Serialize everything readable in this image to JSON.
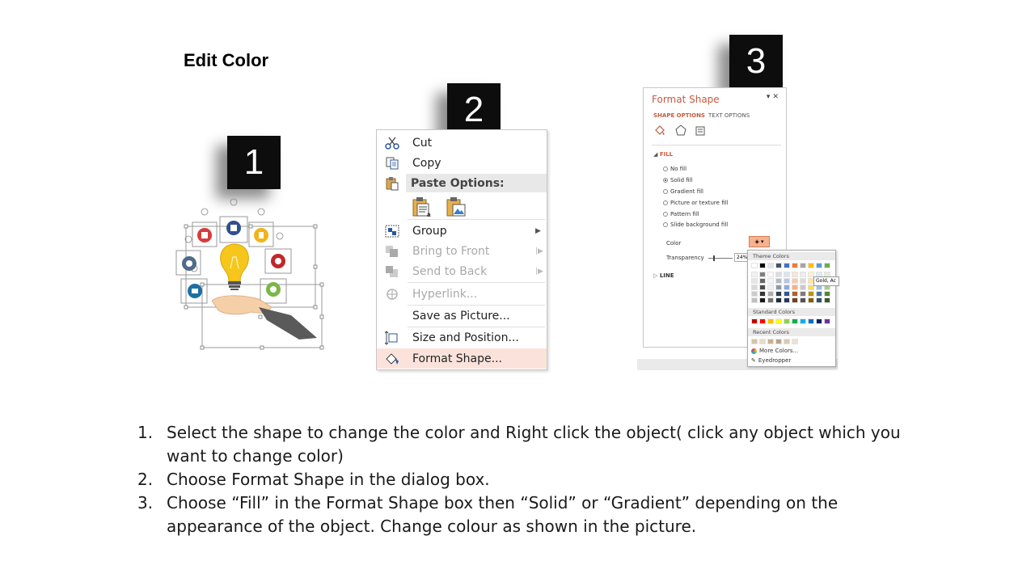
{
  "slide": {
    "title": "Edit Color"
  },
  "steps": {
    "s1": "1",
    "s2": "2",
    "s3": "3"
  },
  "context_menu": {
    "items": [
      {
        "label": "Cut",
        "icon": "scissors-icon"
      },
      {
        "label": "Copy",
        "icon": "copy-icon"
      },
      {
        "label": "Paste Options:",
        "icon": "paste-icon"
      },
      {
        "label": "Group",
        "icon": "group-icon"
      },
      {
        "label": "Bring to Front",
        "icon": "bring-front-icon"
      },
      {
        "label": "Send to Back",
        "icon": "send-back-icon"
      },
      {
        "label": "Hyperlink...",
        "icon": "hyperlink-icon"
      },
      {
        "label": "Save as Picture...",
        "icon": ""
      },
      {
        "label": "Size and Position...",
        "icon": "size-position-icon"
      },
      {
        "label": "Format Shape...",
        "icon": "format-shape-icon"
      }
    ]
  },
  "format_pane": {
    "title": "Format Shape",
    "tab_shape": "SHAPE OPTIONS",
    "tab_text": "TEXT OPTIONS",
    "fill_header": "FILL",
    "fill_options": [
      "No fill",
      "Solid fill",
      "Gradient fill",
      "Picture or texture fill",
      "Pattern fill",
      "Slide background fill"
    ],
    "selected_fill": "Solid fill",
    "color_label": "Color",
    "transparency_label": "Transparency",
    "transparency_value": "24%",
    "line_header": "LINE"
  },
  "color_picker": {
    "theme_header": "Theme Colors",
    "standard_header": "Standard Colors",
    "recent_header": "Recent Colors",
    "more_colors": "More Colors...",
    "eyedropper": "Eyedropper",
    "tooltip": "Gold, Ac",
    "theme_top": [
      "#ffffff",
      "#000000",
      "#e7e6e6",
      "#44546a",
      "#4472c4",
      "#ed7d31",
      "#a5a5a5",
      "#ffc000",
      "#5b9bd5",
      "#70ad47"
    ],
    "standard": [
      "#c00000",
      "#ff0000",
      "#ffc000",
      "#ffff00",
      "#92d050",
      "#00b050",
      "#00b0f0",
      "#0070c0",
      "#002060",
      "#7030a0"
    ],
    "recent": [
      "#d9c3a5",
      "#e8dcc8",
      "#c9b28f",
      "#b8a58a",
      "#d8cbb5",
      "#ede3d3"
    ]
  },
  "instructions": [
    {
      "num": "1.",
      "text": "Select the shape to change the color and Right click the object( click any object which you want to change color)"
    },
    {
      "num": "2.",
      "text": "Choose Format Shape in the dialog box."
    },
    {
      "num": "3.",
      "text": "Choose “Fill” in the Format Shape box then “Solid” or “Gradient” depending on the appearance of the object. Change colour as shown in the picture."
    }
  ]
}
